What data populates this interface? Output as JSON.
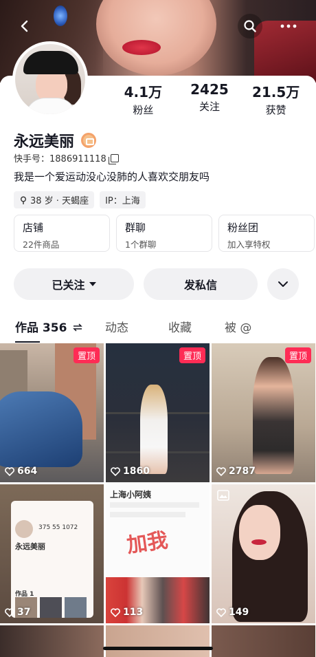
{
  "header": {
    "back_icon": "chevron-left-icon",
    "search_icon": "search-icon",
    "more_icon": "more-dots-icon"
  },
  "profile": {
    "name": "永远美丽",
    "kuaishou_id": "快手号：1886911118",
    "bio": "我是一个爱运动没心没肺的人喜欢交朋友吗",
    "tags": [
      "38 岁 · 天蝎座",
      "IP：上海"
    ],
    "stats": [
      {
        "value": "4.1万",
        "label": "粉丝"
      },
      {
        "value": "2425",
        "label": "关注"
      },
      {
        "value": "21.5万",
        "label": "获赞"
      }
    ]
  },
  "cards": [
    {
      "title": "店铺",
      "sub": "22件商品"
    },
    {
      "title": "群聊",
      "sub": "1个群聊"
    },
    {
      "title": "粉丝团",
      "sub": "加入享特权"
    }
  ],
  "actions": {
    "follow": "已关注",
    "message": "发私信"
  },
  "tabs": [
    {
      "label": "作品 356"
    },
    {
      "label": "动态"
    },
    {
      "label": "收藏"
    },
    {
      "label": "被 @"
    }
  ],
  "grid": [
    {
      "likes": "664",
      "pinned": "置顶"
    },
    {
      "likes": "1860",
      "pinned": "置顶"
    },
    {
      "likes": "2787",
      "pinned": "置顶"
    },
    {
      "likes": "37"
    },
    {
      "likes": "113"
    },
    {
      "likes": "149"
    }
  ],
  "tile5_texts": {
    "title": "上海小阿姨",
    "stamp": "加我"
  },
  "tile4_texts": {
    "name": "永远美丽",
    "stats": "375  55  1072",
    "tab": "作品 1"
  },
  "colors": {
    "pin": "#fe2c55",
    "accent_text": "#161823",
    "button_bg": "#f1f1f3"
  }
}
